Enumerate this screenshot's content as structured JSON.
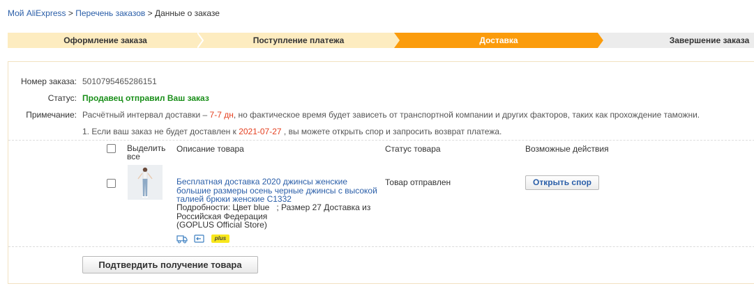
{
  "breadcrumb": {
    "items": [
      {
        "label": "Мой AliExpress",
        "link": true
      },
      {
        "label": "Перечень заказов",
        "link": true
      },
      {
        "label": "Данные о заказе",
        "link": false
      }
    ],
    "separator": ">"
  },
  "steps": [
    {
      "label": "Оформление заказа",
      "state": "done"
    },
    {
      "label": "Поступление платежа",
      "state": "done"
    },
    {
      "label": "Доставка",
      "state": "active"
    },
    {
      "label": "Завершение заказа",
      "state": "pending"
    }
  ],
  "colors": {
    "step_done": "#fdecc0",
    "step_active": "#fb9c0c",
    "step_pending": "#ececec",
    "link": "#2a5ea8",
    "status_green": "#1a8f1a",
    "highlight_red": "#e43f1f"
  },
  "order": {
    "number_label": "Номер заказа:",
    "number": "5010795465286151",
    "status_label": "Статус:",
    "status": "Продавец отправил Ваш заказ",
    "note_label": "Примечание:",
    "note_prefix": "Расчётный интервал доставки –",
    "note_interval": "7-7 дн",
    "note_suffix": ", но фактическое время будет зависеть от транспортной компании и других факторов, таких как прохождение таможни.",
    "dispute_prefix": "1. Если ваш заказ не будет доставлен к",
    "dispute_date": "2021-07-27",
    "dispute_suffix": ", вы можете открыть спор и запросить возврат платежа."
  },
  "table": {
    "headers": {
      "select_all": "Выделить все",
      "description": "Описание товара",
      "status": "Статус товара",
      "actions": "Возможные действия"
    },
    "rows": [
      {
        "title": "Бесплатная доставка 2020 джинсы женские большие размеры осень черные джинсы с высокой талией брюки женские C1332",
        "details_line1": "Подробности: Цвет blue   ; Размер 27 Доставка из",
        "details_line2": "Российская Федерация",
        "store": "(GOPLUS Official Store)",
        "status": "Товар отправлен",
        "action_label": "Открыть спор",
        "icons": [
          "truck-icon",
          "return-icon",
          "plus-badge"
        ],
        "badge_text": "plus"
      }
    ]
  },
  "confirm_button": "Подтвердить получение товара"
}
